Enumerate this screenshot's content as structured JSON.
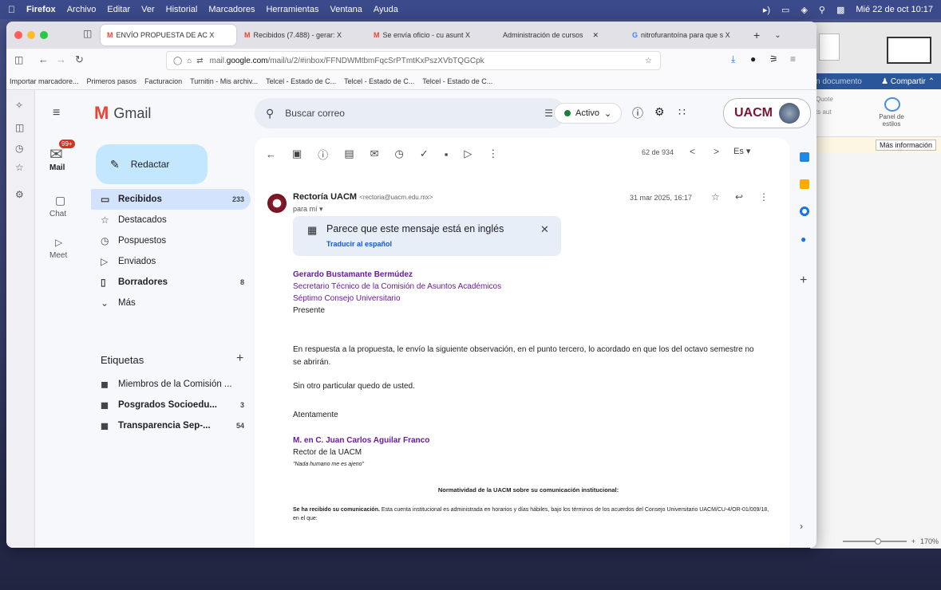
{
  "os": {
    "apple": "",
    "app": "Firefox",
    "menus": [
      "Archivo",
      "Editar",
      "Ver",
      "Historial",
      "Marcadores",
      "Herramientas",
      "Ventana",
      "Ayuda"
    ],
    "clock": "Mié 22 de oct  10:17"
  },
  "tabs": [
    {
      "label": "ENVÍO PROPUESTA DE AC X",
      "active": true
    },
    {
      "label": "Recibidos (7.488) - gerar: X"
    },
    {
      "label": "Se envía oficio - cu asunt X"
    },
    {
      "label": "Administración de cursos"
    },
    {
      "label": "nitrofurantoína para que s X"
    }
  ],
  "url": {
    "prefix": "mail.",
    "domain": "google.com",
    "rest": "/mail/u/2/#inbox/FFNDWMtbmFqcSrPTmtKxPszXVbTQGCpk"
  },
  "bookmarks": [
    "Importar marcadore...",
    "Primeros pasos",
    "Facturacion",
    "Turnitin - Mis archiv...",
    "Telcel - Estado de C...",
    "Telcel - Estado de C...",
    "Telcel - Estado de C..."
  ],
  "word": {
    "doc": "n documento",
    "share": "Compartir",
    "pane_left": "Quote",
    "pane_left2": "ts aut",
    "pane": "Panel de estilos",
    "more": "Más información",
    "zoom": "170%"
  },
  "gmail": {
    "logo": "Gmail",
    "search_placeholder": "Buscar correo",
    "status": "Activo",
    "brand": "UACM",
    "compose": "Redactar",
    "rail": [
      {
        "label": "Mail",
        "badge": "99+"
      },
      {
        "label": "Chat"
      },
      {
        "label": "Meet"
      }
    ],
    "folders": [
      {
        "label": "Recibidos",
        "count": "233",
        "icon": "inbox-icon"
      },
      {
        "label": "Destacados",
        "count": "",
        "icon": "star-icon"
      },
      {
        "label": "Pospuestos",
        "count": "",
        "icon": "clock-icon"
      },
      {
        "label": "Enviados",
        "count": "",
        "icon": "send-icon"
      },
      {
        "label": "Borradores",
        "count": "8",
        "icon": "draft-icon"
      },
      {
        "label": "Más",
        "count": "",
        "icon": "chevron-down-icon"
      }
    ],
    "labels_title": "Etiquetas",
    "labels": [
      {
        "label": "Miembros de la Comisión ...",
        "count": ""
      },
      {
        "label": "Posgrados Socioedu...",
        "count": "3"
      },
      {
        "label": "Transparencia Sep-...",
        "count": "54"
      }
    ],
    "pager": "62 de 934",
    "lang": "Es",
    "sender": "Rectoría UACM",
    "sender_email": "<rectoria@uacm.edu.mx>",
    "to": "para mí",
    "date": "31 mar 2025, 16:17",
    "translate": {
      "title": "Parece que este mensaje está en inglés",
      "link": "Traducir al español"
    },
    "body": {
      "to_name": "Gerardo Bustamante Bermúdez",
      "to_l1": "Secretario Técnico de la Comisión de Asuntos Académicos",
      "to_l2": "Séptimo Consejo Universitario",
      "to_l3": "Presente",
      "p1": "En respuesta a la propuesta, le envío la siguiente observación, en el punto tercero, lo acordado en que los del octavo semestre no se abrirán.",
      "p2": "Sin otro particular quedo de usted.",
      "p3": "Atentamente",
      "sig_name": "M. en C. Juan Carlos Aguilar Franco",
      "sig_role": "Rector de la UACM",
      "sig_motto": "\"Nada humano me es ajeno\"",
      "norm_title": "Normatividad de la UACM sobre su comunicación institucional:",
      "norm_bold": "Se ha recibido su comunicación.",
      "norm_text": " Esta cuenta institucional es administrada en horarios y días hábiles, bajo los términos de los acuerdos del Consejo Universitario UACM/CU-4/OR-01/009/18, en el que:"
    }
  }
}
